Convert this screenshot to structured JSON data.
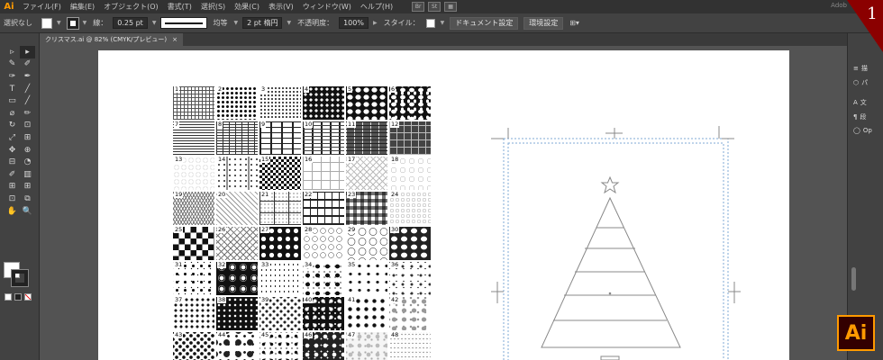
{
  "app": {
    "logo": "Ai"
  },
  "menus": [
    "ファイル(F)",
    "編集(E)",
    "オブジェクト(O)",
    "書式(T)",
    "選択(S)",
    "効果(C)",
    "表示(V)",
    "ウィンドウ(W)",
    "ヘルプ(H)"
  ],
  "menu_icons": [
    "Br",
    "St"
  ],
  "menu_search": "Adob",
  "control": {
    "selection": "選択なし",
    "stroke_label": "線：",
    "stroke_value": "0.25 pt",
    "profile": "均等",
    "brush": "2 pt 楕円",
    "opacity_label": "不透明度：",
    "opacity_value": "100%",
    "style_label": "スタイル：",
    "doc_settings": "ドキュメント設定",
    "prefs": "環境設定"
  },
  "document_tab": {
    "title": "クリスマス.ai @ 82% (CMYK/プレビュー)",
    "close": "×"
  },
  "tools": [
    "▹",
    "▸",
    "✎",
    "✐",
    "✑",
    "✒",
    "T",
    "╱",
    "▭",
    "╱",
    "⌀",
    "✏",
    "↻",
    "⊡",
    "⤢",
    "⊞",
    "✥",
    "⊕",
    "⊟",
    "◔",
    "✐",
    "▥",
    "⊞",
    "⊞",
    "⊡",
    "⧉",
    "✋",
    "🔍"
  ],
  "swatches": [
    "1",
    "2",
    "3",
    "4",
    "5",
    "6",
    "7",
    "8",
    "9",
    "10",
    "11",
    "12",
    "13",
    "14",
    "15",
    "16",
    "17",
    "18",
    "19",
    "20",
    "21",
    "22",
    "23",
    "24",
    "25",
    "26",
    "27",
    "28",
    "29",
    "30",
    "31",
    "32",
    "33",
    "34",
    "35",
    "36",
    "37",
    "38",
    "39",
    "40",
    "41",
    "42",
    "43",
    "44",
    "45",
    "46",
    "47",
    "48"
  ],
  "right_panel": {
    "items": [
      "描",
      "パ",
      "文",
      "段",
      "Op"
    ]
  },
  "badges": {
    "step": "1",
    "logo": "Ai"
  },
  "colors": {
    "accent": "#ff9a00",
    "badge_red": "#8b0000"
  }
}
